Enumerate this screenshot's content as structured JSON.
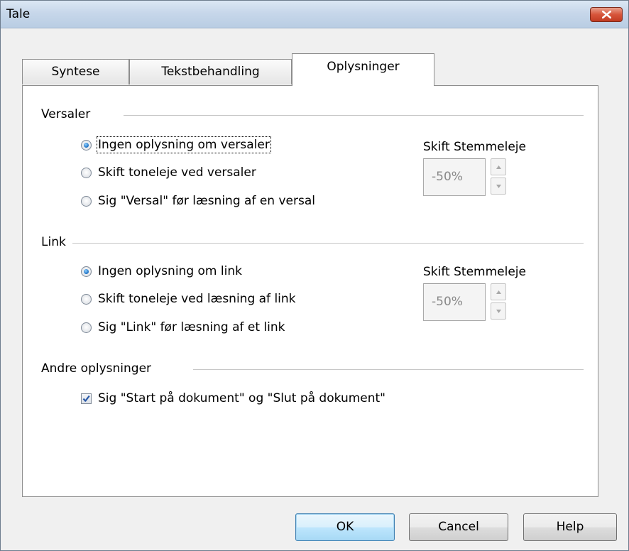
{
  "window": {
    "title": "Tale"
  },
  "tabs": [
    {
      "label": "Syntese"
    },
    {
      "label": "Tekstbehandling"
    },
    {
      "label": "Oplysninger"
    }
  ],
  "versaler": {
    "label": "Versaler",
    "options": [
      {
        "label": "Ingen oplysning om versaler",
        "selected": true
      },
      {
        "label": "Skift toneleje ved versaler",
        "selected": false
      },
      {
        "label": "Sig \"Versal\" før læsning af en versal",
        "selected": false
      }
    ],
    "pitch_label": "Skift Stemmeleje",
    "pitch_value": "-50%"
  },
  "link": {
    "label": "Link",
    "options": [
      {
        "label": "Ingen oplysning om link",
        "selected": true
      },
      {
        "label": "Skift toneleje ved læsning af link",
        "selected": false
      },
      {
        "label": "Sig \"Link\" før læsning af et link",
        "selected": false
      }
    ],
    "pitch_label": "Skift Stemmeleje",
    "pitch_value": "-50%"
  },
  "other": {
    "label": "Andre oplysninger",
    "checkbox_label": "Sig \"Start på dokument\" og \"Slut på dokument\"",
    "checked": true
  },
  "buttons": {
    "ok": "OK",
    "cancel": "Cancel",
    "help": "Help"
  },
  "colors": {
    "titlebar": "#c7d7ea",
    "close": "#d7553b",
    "accent": "#1a6ec2"
  }
}
